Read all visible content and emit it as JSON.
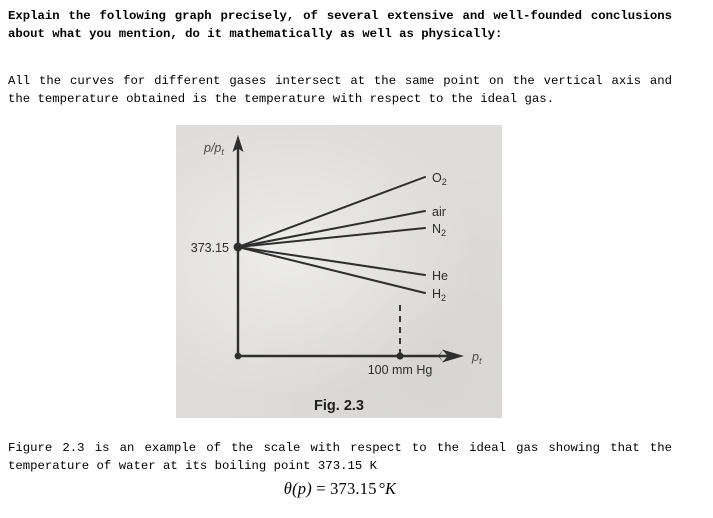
{
  "document": {
    "intro_paragraph": "Explain the following graph precisely, of several extensive and well-founded conclusions about what you mention, do it mathematically as well as physically:",
    "statement_paragraph": "All the curves for different gases intersect at the same point on the vertical axis and the temperature obtained is the temperature with respect to the ideal gas.",
    "closing_paragraph": "Figure 2.3 is an example of the scale with respect to the ideal gas showing that the temperature of water at its boiling point 373.15 K",
    "equation": "θ(p) = 373.15 °K",
    "equation_parts": {
      "theta": "θ",
      "open": "(",
      "p": "p",
      "close": ")",
      "equals": " = ",
      "value": "373.15",
      "unit": "°K"
    }
  },
  "figure": {
    "caption": "Fig. 2.3",
    "y_axis_label": "p/p",
    "y_axis_label_sub": "t",
    "x_axis_label": "p",
    "x_axis_label_sub": "t",
    "y_intercept_label": "373.15",
    "x_tick_label": "100 mm Hg",
    "background_color": "#dedddb",
    "line_color": "#2e2e2e",
    "curves": [
      {
        "name": "O2",
        "label": "O",
        "label_sub": "2",
        "end_y_value": 177
      },
      {
        "name": "air",
        "label": "air",
        "label_sub": "",
        "end_y_value": 211
      },
      {
        "name": "N2",
        "label": "N",
        "label_sub": "2",
        "end_y_value": 228
      },
      {
        "name": "He",
        "label": "He",
        "label_sub": "",
        "end_y_value": 275
      },
      {
        "name": "H2",
        "label": "H",
        "label_sub": "2",
        "end_y_value": 293
      }
    ]
  },
  "chart_data": {
    "type": "line",
    "title": "Fig. 2.3",
    "xlabel": "p_t",
    "ylabel": "p/p_t",
    "grid": false,
    "legend_position": "right-inline",
    "common_intercept": 373.15,
    "intercept_label": "373.15",
    "x_tick_labels": [
      "100 mm Hg"
    ],
    "annotations": [
      "dashed vertical line at 100 mm Hg"
    ],
    "series": [
      {
        "name": "O2",
        "label": "O₂",
        "slope_sign": "positive",
        "relative_slope": 1.0
      },
      {
        "name": "air",
        "label": "air",
        "slope_sign": "positive",
        "relative_slope": 0.63
      },
      {
        "name": "N2",
        "label": "N₂",
        "slope_sign": "positive",
        "relative_slope": 0.45
      },
      {
        "name": "He",
        "label": "He",
        "slope_sign": "negative",
        "relative_slope": -0.43
      },
      {
        "name": "H2",
        "label": "H₂",
        "slope_sign": "negative",
        "relative_slope": -0.63
      }
    ]
  }
}
